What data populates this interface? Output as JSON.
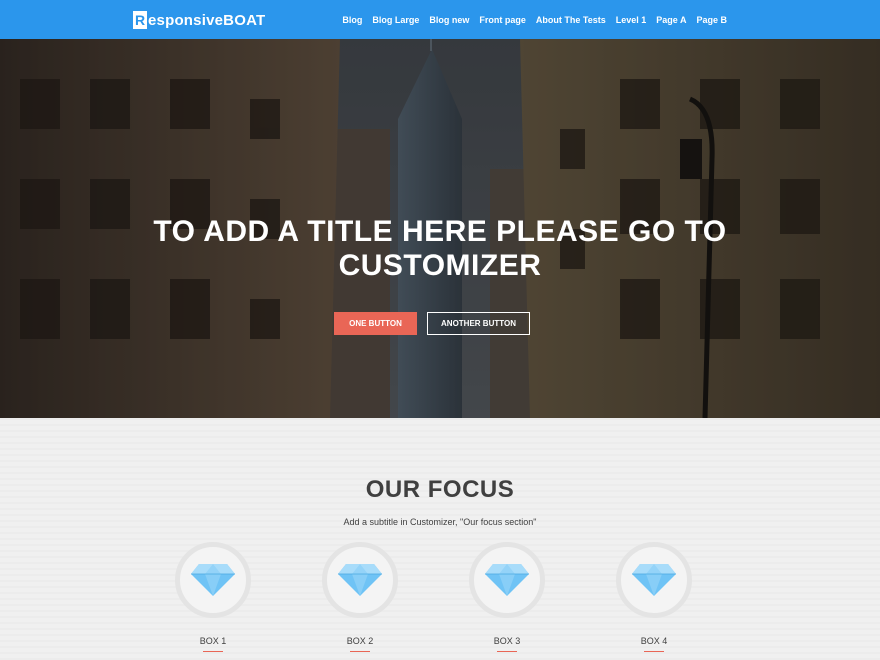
{
  "header": {
    "logo_letter": "R",
    "logo_text": "esponsiveBOAT",
    "nav": [
      "Blog",
      "Blog Large",
      "Blog new",
      "Front page",
      "About The Tests",
      "Level 1",
      "Page A",
      "Page B"
    ]
  },
  "hero": {
    "title_line1": "TO ADD A TITLE HERE PLEASE GO TO",
    "title_line2": "CUSTOMIZER",
    "button_one": "ONE BUTTON",
    "button_two": "ANOTHER BUTTON"
  },
  "focus": {
    "title": "OUR FOCUS",
    "subtitle": "Add a subtitle in Customizer, \"Our focus section\"",
    "boxes": [
      "BOX 1",
      "BOX 2",
      "BOX 3",
      "BOX 4"
    ]
  },
  "colors": {
    "header_bg": "#2b96ec",
    "accent": "#e96656",
    "text_dark": "#404040",
    "diamond": "#6fc3f5"
  },
  "icons": {
    "box_icon": "diamond-icon"
  }
}
